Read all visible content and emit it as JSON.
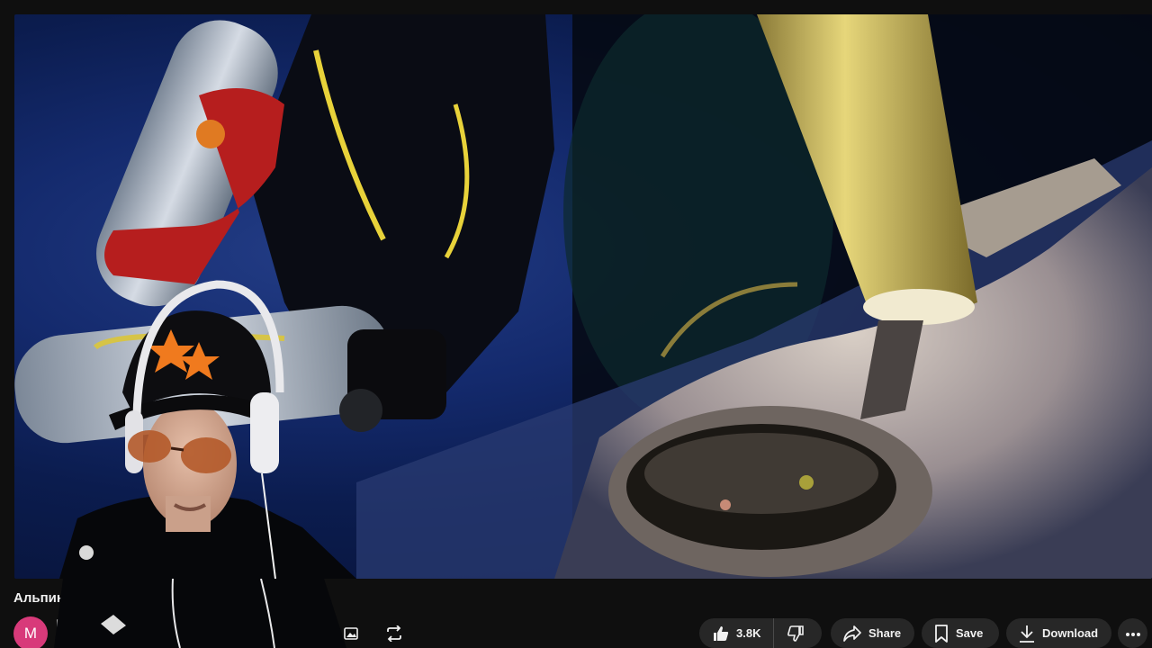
{
  "video": {
    "title": "Альпин"
  },
  "channel": {
    "avatar_letter": "M"
  },
  "actions": {
    "like_count": "3.8K",
    "share_label": "Share",
    "save_label": "Save",
    "download_label": "Download"
  },
  "icons": {
    "like": "thumbs-up-icon",
    "dislike": "thumbs-down-icon",
    "share": "share-arrow-icon",
    "save": "bookmark-icon",
    "download": "download-icon",
    "more": "more-horizontal-icon",
    "image": "image-icon",
    "repeat": "repeat-icon"
  },
  "colors": {
    "background": "#0f0f0f",
    "pill": "#272727",
    "avatar": "#d83a7a",
    "text": "#f1f1f1"
  }
}
